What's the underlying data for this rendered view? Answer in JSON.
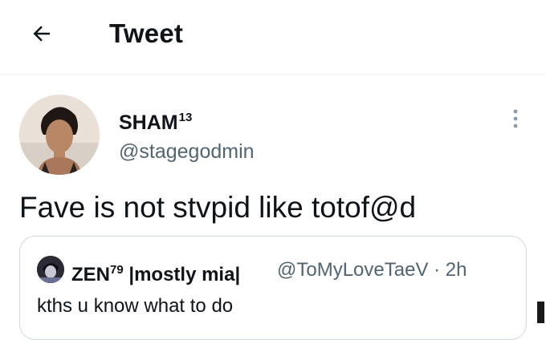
{
  "header": {
    "title": "Tweet",
    "back_icon": "arrow-left-icon"
  },
  "author": {
    "display_name": "SHAM",
    "display_name_sup": "13",
    "handle": "@stagegodmin",
    "avatar_icon": "avatar"
  },
  "tweet": {
    "text": "Fave is not stvpid like totof@d"
  },
  "quote": {
    "display_name": "ZEN",
    "display_name_sup": "79",
    "name_suffix": " |mostly mia|",
    "handle_time": "@ToMyLoveTaeV · 2h",
    "text": "kths u know what to do"
  },
  "colors": {
    "primary_text": "#0f1419",
    "secondary_text": "#536471",
    "border": "#cfd9de"
  }
}
